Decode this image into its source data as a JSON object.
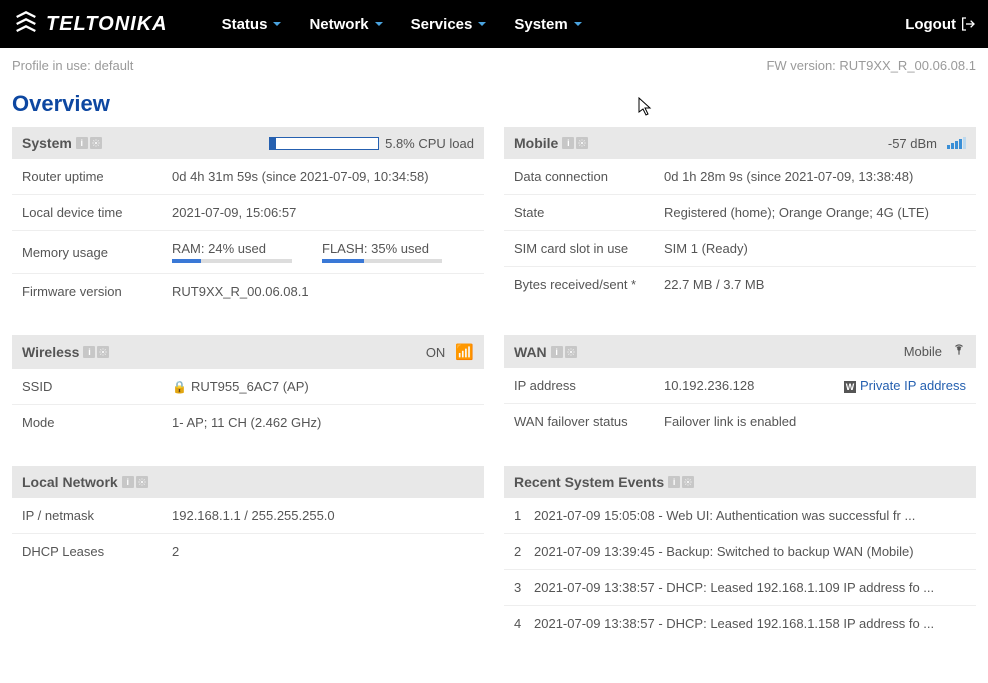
{
  "header": {
    "brand": "TELTONIKA",
    "nav": {
      "status": "Status",
      "network": "Network",
      "services": "Services",
      "system": "System"
    },
    "logout": "Logout"
  },
  "subheader": {
    "profile_label": "Profile in use:",
    "profile_value": "default",
    "fw_label": "FW version:",
    "fw_value": "RUT9XX_R_00.06.08.1"
  },
  "page_title": "Overview",
  "system": {
    "title": "System",
    "cpu_pct": 5.8,
    "cpu_label": "5.8% CPU load",
    "rows": {
      "uptime_k": "Router uptime",
      "uptime_v": "0d 4h 31m 59s (since 2021-07-09, 10:34:58)",
      "time_k": "Local device time",
      "time_v": "2021-07-09, 15:06:57",
      "mem_k": "Memory usage",
      "ram_lbl": "RAM",
      "ram_val": "24% used",
      "ram_pct": 24,
      "flash_lbl": "FLASH",
      "flash_val": "35% used",
      "flash_pct": 35,
      "fw_k": "Firmware version",
      "fw_v": "RUT9XX_R_00.06.08.1"
    }
  },
  "mobile": {
    "title": "Mobile",
    "signal": "-57 dBm",
    "rows": {
      "conn_k": "Data connection",
      "conn_v": "0d 1h 28m 9s (since 2021-07-09, 13:38:48)",
      "state_k": "State",
      "state_v": "Registered (home); Orange Orange; 4G (LTE)",
      "sim_k": "SIM card slot in use",
      "sim_v": "SIM 1 (Ready)",
      "bytes_k": "Bytes received/sent *",
      "bytes_v": "22.7 MB / 3.7 MB"
    }
  },
  "wireless": {
    "title": "Wireless",
    "status": "ON",
    "rows": {
      "ssid_k": "SSID",
      "ssid_v": "RUT955_6AC7 (AP)",
      "mode_k": "Mode",
      "mode_v": "1- AP; 11 CH (2.462 GHz)"
    }
  },
  "wan": {
    "title": "WAN",
    "status": "Mobile",
    "link": "Private IP address",
    "rows": {
      "ip_k": "IP address",
      "ip_v": "10.192.236.128",
      "fo_k": "WAN failover status",
      "fo_v": "Failover link is enabled"
    }
  },
  "local": {
    "title": "Local Network",
    "rows": {
      "ip_k": "IP / netmask",
      "ip_v": "192.168.1.1 / 255.255.255.0",
      "dhcp_k": "DHCP Leases",
      "dhcp_v": "2"
    }
  },
  "events": {
    "title": "Recent System Events",
    "items": [
      {
        "n": "1",
        "text": "2021-07-09 15:05:08 - Web UI: Authentication was successful fr ..."
      },
      {
        "n": "2",
        "text": "2021-07-09 13:39:45 - Backup: Switched to backup WAN (Mobile)"
      },
      {
        "n": "3",
        "text": "2021-07-09 13:38:57 - DHCP: Leased 192.168.1.109 IP address fo ..."
      },
      {
        "n": "4",
        "text": "2021-07-09 13:38:57 - DHCP: Leased 192.168.1.158 IP address fo ..."
      }
    ]
  }
}
